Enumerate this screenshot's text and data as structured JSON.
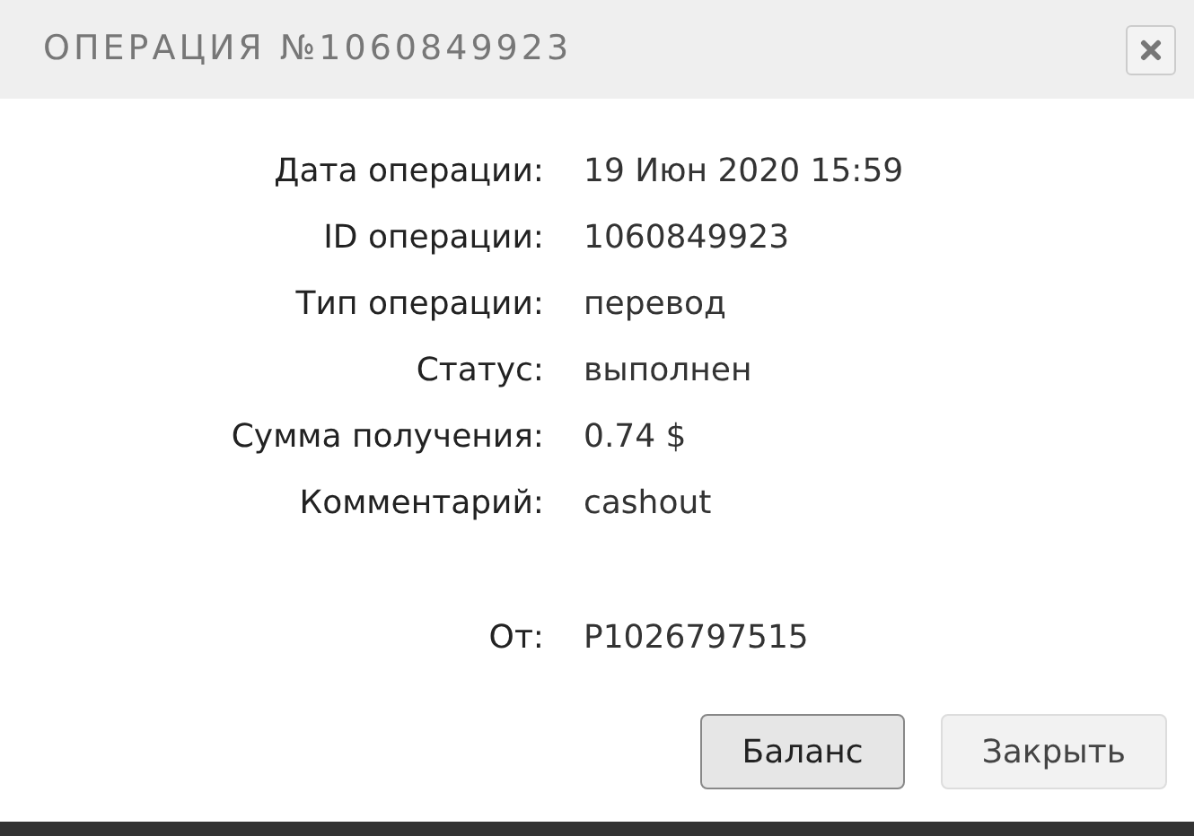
{
  "dialog": {
    "title": "ОПЕРАЦИЯ №1060849923"
  },
  "details": [
    {
      "label": "Дата операции:",
      "value": "19 Июн 2020 15:59"
    },
    {
      "label": "ID операции:",
      "value": "1060849923"
    },
    {
      "label": "Тип операции:",
      "value": "перевод"
    },
    {
      "label": "Статус:",
      "value": "выполнен"
    },
    {
      "label": "Сумма получения:",
      "value": "0.74 $"
    },
    {
      "label": "Комментарий:",
      "value": "cashout"
    }
  ],
  "sender": {
    "label": "От:",
    "value": "P1026797515"
  },
  "buttons": [
    {
      "label": "Баланс",
      "focused": true
    },
    {
      "label": "Закрыть",
      "focused": false
    }
  ]
}
